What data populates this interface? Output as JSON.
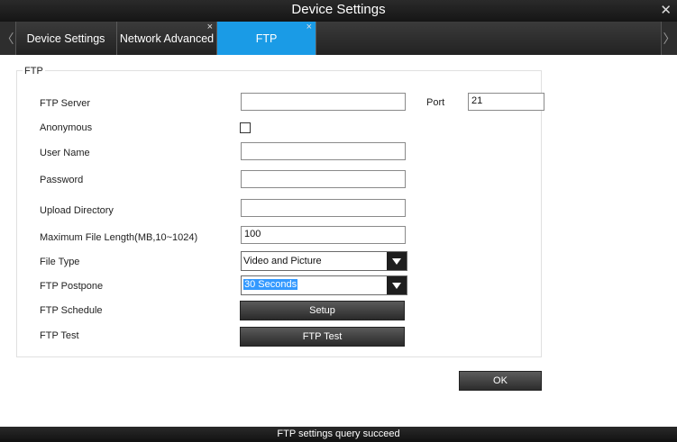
{
  "window": {
    "title": "Device Settings",
    "close_glyph": "✕"
  },
  "tabs": {
    "left_arrow": "〈",
    "right_arrow": "〉",
    "close_glyph": "×",
    "items": [
      {
        "label": "Device Settings"
      },
      {
        "label": "Network Advanced"
      },
      {
        "label": "FTP"
      }
    ],
    "active_color": "#1a9be6"
  },
  "ftp": {
    "group_title": "FTP",
    "server_label": "FTP Server",
    "server_value": "",
    "port_label": "Port",
    "port_value": "21",
    "anonymous_label": "Anonymous",
    "anonymous_checked": false,
    "username_label": "User Name",
    "username_value": "",
    "password_label": "Password",
    "password_value": "",
    "upload_dir_label": "Upload Directory",
    "upload_dir_value": "",
    "max_file_length_label": "Maximum File Length(MB,10~1024)",
    "max_file_length_value": "100",
    "file_type_label": "File Type",
    "file_type_value": "Video and Picture",
    "postpone_label": "FTP Postpone",
    "postpone_value": "30 Seconds",
    "schedule_label": "FTP Schedule",
    "schedule_button": "Setup",
    "test_label": "FTP Test",
    "test_button": "FTP Test"
  },
  "ok_button": "OK",
  "status": "FTP  settings query succeed"
}
